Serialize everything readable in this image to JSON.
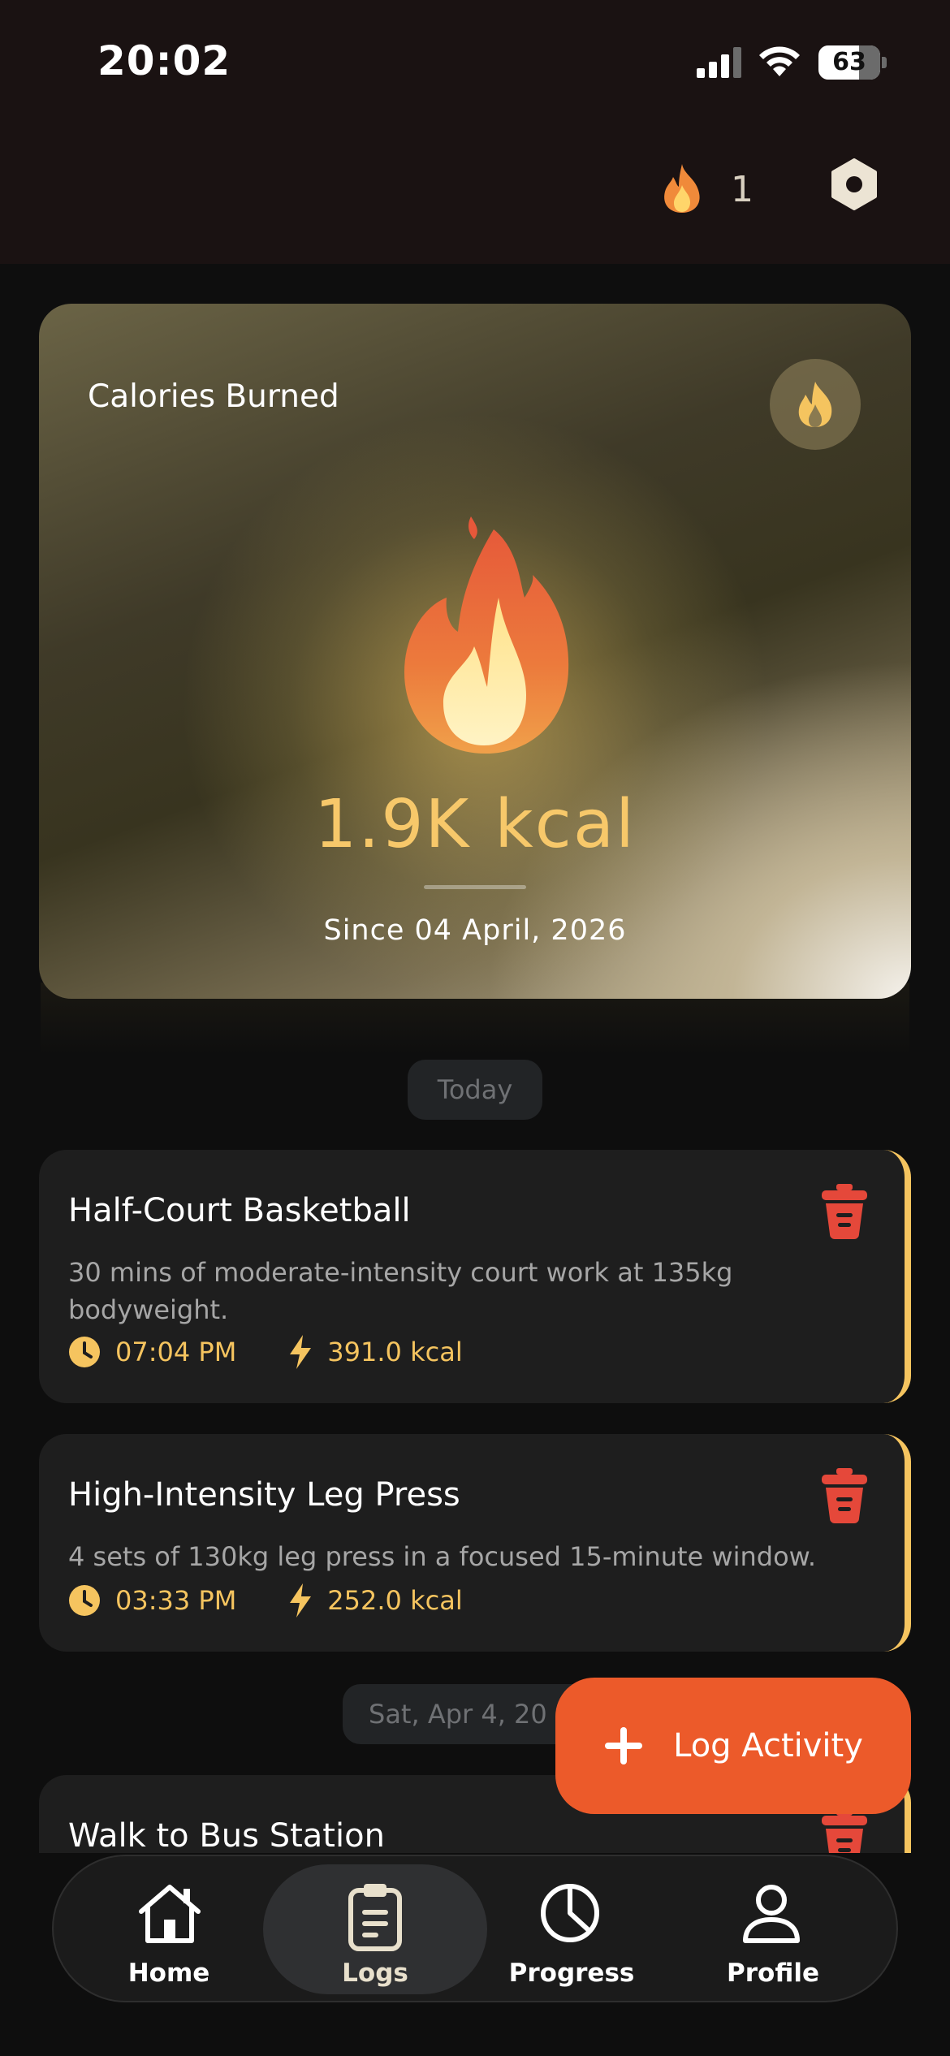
{
  "status_bar": {
    "time": "20:02",
    "battery": "63"
  },
  "header": {
    "streak_count": "1",
    "streak_icon": "fire-icon",
    "settings_icon": "gear-icon"
  },
  "calories_card": {
    "title": "Calories Burned",
    "value": "1.9K",
    "unit": "kcal",
    "since": "Since 04 April, 2026",
    "badge_icon": "fire-icon"
  },
  "date_groups": [
    {
      "label": "Today"
    },
    {
      "label": "Sat, Apr 4, 20"
    }
  ],
  "activities": [
    {
      "title": "Half-Court Basketball",
      "description": "30 mins of moderate-intensity court work at 135kg bodyweight.",
      "time": "07:04 PM",
      "kcal": "391.0 kcal"
    },
    {
      "title": "High-Intensity Leg Press",
      "description": "4 sets of 130kg leg press in a focused 15-minute window.",
      "time": "03:33 PM",
      "kcal": "252.0 kcal"
    },
    {
      "title": "Walk to Bus Station"
    }
  ],
  "fab": {
    "label": "Log Activity"
  },
  "nav": [
    {
      "label": "Home",
      "icon": "home-icon"
    },
    {
      "label": "Logs",
      "icon": "clipboard-icon",
      "active": true
    },
    {
      "label": "Progress",
      "icon": "pie-chart-icon"
    },
    {
      "label": "Profile",
      "icon": "user-icon"
    }
  ],
  "colors": {
    "accent": "#f5c45f",
    "fab": "#ec5a2a",
    "danger": "#e5483a",
    "background": "#0e0e0e",
    "card": "#1e1e1e"
  }
}
